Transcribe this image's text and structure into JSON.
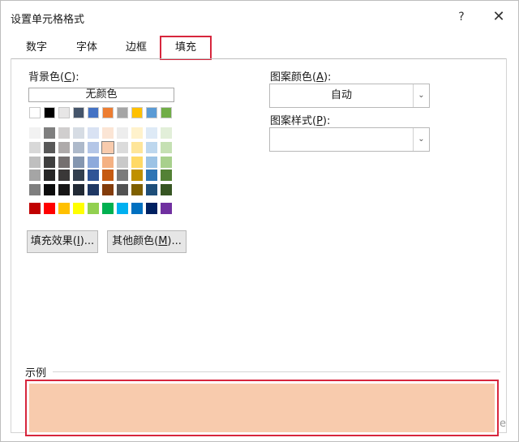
{
  "window": {
    "title": "设置单元格格式",
    "help_label": "?",
    "close_label": "✕"
  },
  "tabs": [
    {
      "label": "数字",
      "active": false
    },
    {
      "label": "字体",
      "active": false
    },
    {
      "label": "边框",
      "active": false
    },
    {
      "label": "填充",
      "active": true
    }
  ],
  "fill": {
    "background_color_label": "背景色(",
    "background_color_key": "C",
    "background_color_suffix": "):",
    "no_color_label": "无颜色",
    "fill_effects_prefix": "填充效果(",
    "fill_effects_key": "I",
    "fill_effects_suffix": ")...",
    "more_colors_prefix": "其他颜色(",
    "more_colors_key": "M",
    "more_colors_suffix": ")...",
    "selected_color": "#f8cbad"
  },
  "palette": {
    "theme_top": [
      "#ffffff",
      "#000000",
      "#e7e6e6",
      "#44546a",
      "#4472c4",
      "#ed7d31",
      "#a5a5a5",
      "#ffc000",
      "#5b9bd5",
      "#70ad47"
    ],
    "theme_shades": [
      [
        "#f2f2f2",
        "#7f7f7f",
        "#d0cece",
        "#d6dce4",
        "#d9e2f3",
        "#fbe5d5",
        "#ededed",
        "#fff2cc",
        "#deeaf6",
        "#e2efd9"
      ],
      [
        "#d8d8d8",
        "#595959",
        "#aeaaaa",
        "#adb9ca",
        "#b4c6e7",
        "#f8cbad",
        "#dbdbdb",
        "#fee599",
        "#bdd7ee",
        "#c5e0b3"
      ],
      [
        "#bfbfbf",
        "#3f3f3f",
        "#757070",
        "#8496b0",
        "#8eaadb",
        "#f4b183",
        "#c9c9c9",
        "#ffd965",
        "#9cc3e5",
        "#a8d08d"
      ],
      [
        "#a5a5a5",
        "#262626",
        "#3a3838",
        "#323f4f",
        "#2f5496",
        "#c55a11",
        "#7b7b7b",
        "#bf9000",
        "#2e75b5",
        "#538135"
      ],
      [
        "#7f7f7f",
        "#0c0c0c",
        "#171616",
        "#222a35",
        "#1f3864",
        "#833c0b",
        "#525252",
        "#7f6000",
        "#1e4e79",
        "#375623"
      ]
    ],
    "standard": [
      "#c00000",
      "#ff0000",
      "#ffc000",
      "#ffff00",
      "#92d050",
      "#00b050",
      "#00b0f0",
      "#0070c0",
      "#002060",
      "#7030a0"
    ]
  },
  "pattern": {
    "color_prefix": "图案颜色(",
    "color_key": "A",
    "color_suffix": "):",
    "color_value": "自动",
    "style_prefix": "图案样式(",
    "style_key": "P",
    "style_suffix": "):",
    "style_value": ""
  },
  "sample": {
    "label": "示例",
    "edge_glyph": "e"
  },
  "colors": {
    "highlight_border": "#d7263d"
  }
}
